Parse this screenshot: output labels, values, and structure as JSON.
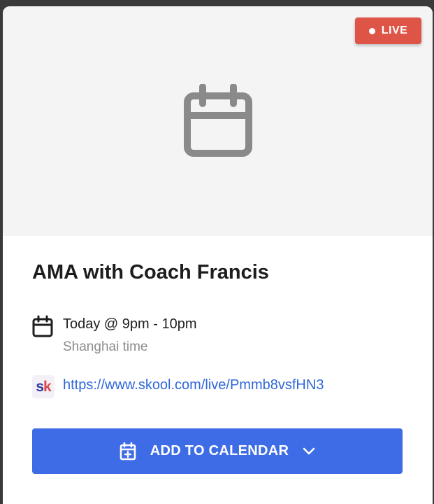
{
  "badge": {
    "label": "LIVE",
    "color": "#de5547"
  },
  "event": {
    "title": "AMA with Coach Francis",
    "time": "Today @ 9pm - 10pm",
    "timezone": "Shanghai time",
    "link_logo_text": "sk",
    "link": "https://www.skool.com/live/Pmmb8vsfHN3"
  },
  "actions": {
    "add_to_calendar_label": "ADD TO CALENDAR",
    "button_color": "#3d6ce6"
  },
  "icons": {
    "cover": "calendar-icon",
    "time_row": "calendar-icon",
    "button_left": "calendar-add-icon",
    "button_right": "chevron-down-icon"
  }
}
